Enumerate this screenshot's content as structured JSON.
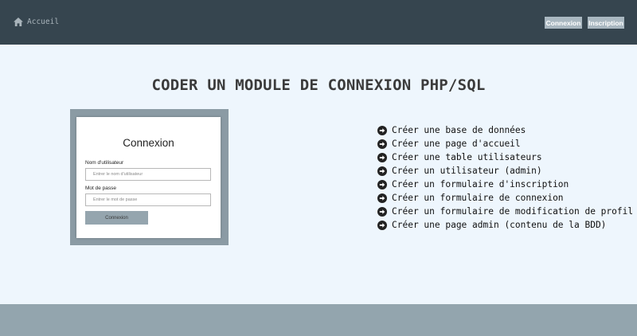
{
  "header": {
    "home_label": "Accueil",
    "login_label": "Connexion",
    "register_label": "Inscription"
  },
  "main": {
    "title": "CODER UN MODULE DE CONNEXION PHP/SQL",
    "form_preview": {
      "title": "Connexion",
      "username_label": "Nom d'utilisateur",
      "username_placeholder": "Entrer le nom d'utilisateur",
      "password_label": "Mot de passe",
      "password_placeholder": "Entrer le mot de passe",
      "submit_label": "Connexion"
    },
    "steps": [
      "Créer une base de données",
      "Créer une page d'accueil",
      "Créer une table utilisateurs",
      "Créer un utilisateur (admin)",
      "Créer un formulaire d'inscription",
      "Créer un formulaire de connexion",
      "Créer un formulaire de modification de profil",
      "Créer une page admin (contenu de la BDD)"
    ]
  },
  "colors": {
    "header_bg": "#36454f",
    "page_bg": "#eef6fd",
    "footer_bg": "#93a5ae",
    "nav_button_bg": "#a9b7c0"
  },
  "icons": {
    "home": "home-icon",
    "step": "arrow-circle-right-icon"
  }
}
